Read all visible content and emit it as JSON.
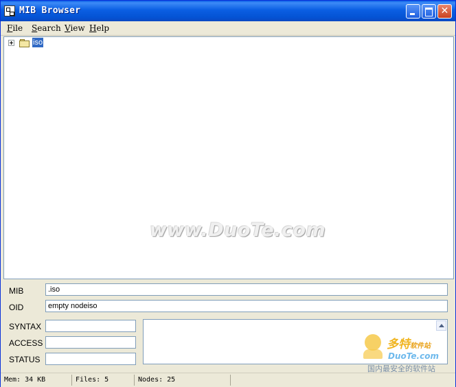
{
  "window": {
    "title": "MIB Browser",
    "controls": {
      "minimize": "minimize-icon",
      "maximize": "maximize-icon",
      "close": "✕"
    }
  },
  "menu": {
    "items": [
      {
        "accel": "F",
        "rest": "ile"
      },
      {
        "accel": "S",
        "rest": "earch"
      },
      {
        "accel": "V",
        "rest": "iew"
      },
      {
        "accel": "H",
        "rest": "elp"
      }
    ]
  },
  "tree": {
    "nodes": [
      {
        "label": "iso",
        "expanded": false,
        "selected": true,
        "icon": "folder-icon"
      }
    ]
  },
  "watermark": "www.DuoTe.com",
  "details": {
    "mib_label": "MIB",
    "mib_value": ".iso",
    "oid_label": "OID",
    "oid_value": "empty nodeiso",
    "syntax_label": "SYNTAX",
    "syntax_value": "",
    "access_label": "ACCESS",
    "access_value": "",
    "status_label": "STATUS",
    "status_value": "",
    "description_value": ""
  },
  "statusbar": {
    "mem": "Mem: 34 KB",
    "files": "Files: 5",
    "nodes": "Nodes: 25"
  },
  "logo": {
    "cn_main": "多特",
    "cn_small": "软件站",
    "en": "DuoTe.com",
    "sub": "国内最安全的软件站"
  },
  "colors": {
    "titlebar": "#0453d4",
    "selection": "#316ac5",
    "chrome": "#ece9d8",
    "border": "#7f9db9"
  }
}
